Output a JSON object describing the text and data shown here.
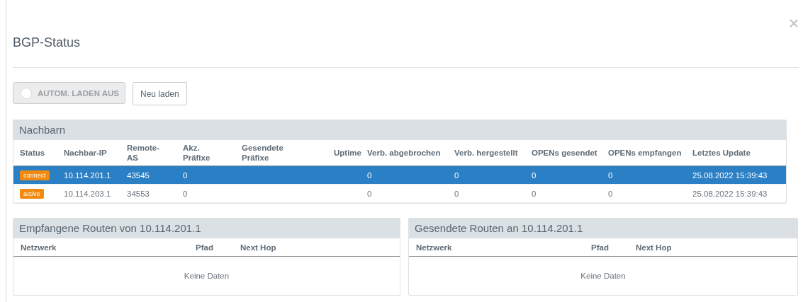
{
  "title": "BGP-Status",
  "toolbar": {
    "autoload": {
      "label": "AUTOM. LADEN AUS",
      "on": false
    },
    "reload_button": "Neu laden"
  },
  "neighbors": {
    "title": "Nachbarn",
    "columns": [
      "Status",
      "Nachbar-IP",
      "Remote-AS",
      "Akz. Präfixe",
      "Gesendete Präfixe",
      "Uptime",
      "Verb. abgebrochen",
      "Verb. hergestellt",
      "OPENs gesendet",
      "OPENs empfangen",
      "Letztes Update"
    ],
    "rows": [
      {
        "selected": true,
        "color": "#f28a0f",
        "cells": [
          "connect",
          "10.114.201.1",
          "43545",
          "0",
          "",
          "",
          "0",
          "0",
          "0",
          "0",
          "25.08.2022 15:39:43"
        ]
      },
      {
        "selected": false,
        "color": "#f28a0f",
        "cells": [
          "active",
          "10.114.203.1",
          "34553",
          "0",
          "",
          "",
          "0",
          "0",
          "0",
          "0",
          "25.08.2022 15:39:43"
        ]
      }
    ]
  },
  "routes": [
    {
      "title": "Empfangene Routen von 10.114.201.1",
      "columns": [
        "Netzwerk",
        "Pfad",
        "Next Hop"
      ],
      "empty": "Keine Daten"
    },
    {
      "title": "Gesendete Routen an 10.114.201.1",
      "columns": [
        "Netzwerk",
        "Pfad",
        "Next Hop"
      ],
      "empty": "Keine Daten"
    }
  ]
}
